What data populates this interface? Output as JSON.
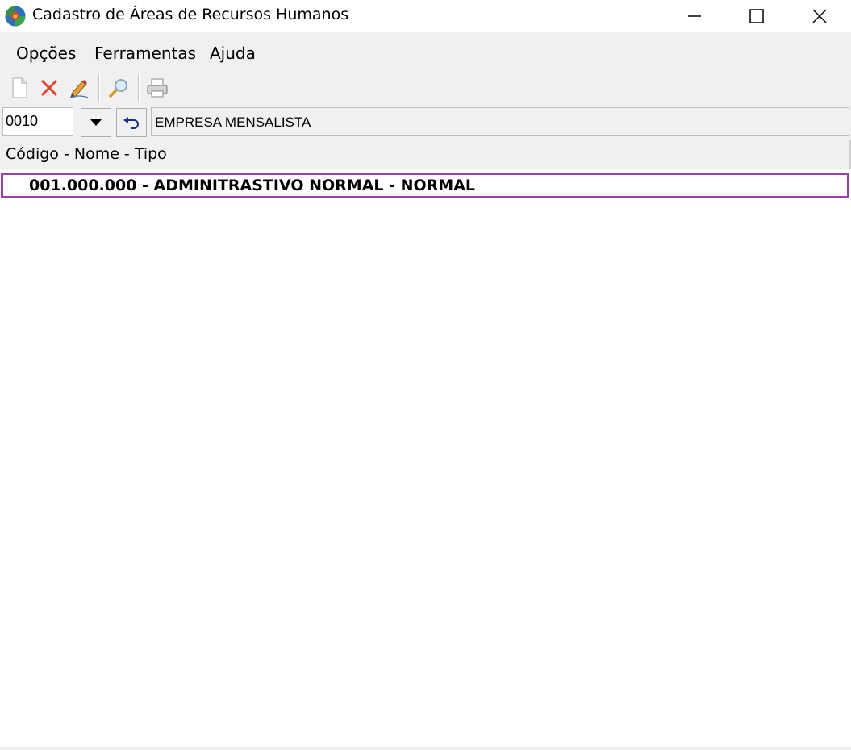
{
  "window": {
    "title": "Cadastro de Áreas de Recursos Humanos"
  },
  "menu": {
    "items": [
      {
        "label": "Opções"
      },
      {
        "label": "Ferramentas"
      },
      {
        "label": "Ajuda"
      }
    ]
  },
  "toolbar": {
    "buttons": [
      {
        "icon": "new-document-icon"
      },
      {
        "icon": "delete-icon"
      },
      {
        "icon": "edit-icon"
      },
      {
        "icon": "search-icon"
      },
      {
        "icon": "print-icon"
      }
    ]
  },
  "company": {
    "code": "0010",
    "name": "EMPRESA MENSALISTA"
  },
  "list": {
    "header": "Código - Nome - Tipo",
    "rows": [
      {
        "text": "001.000.000 - ADMINITRASTIVO NORMAL - NORMAL"
      }
    ]
  },
  "colors": {
    "selection_border": "#9b3fa8",
    "delete_icon": "#e0452c"
  }
}
